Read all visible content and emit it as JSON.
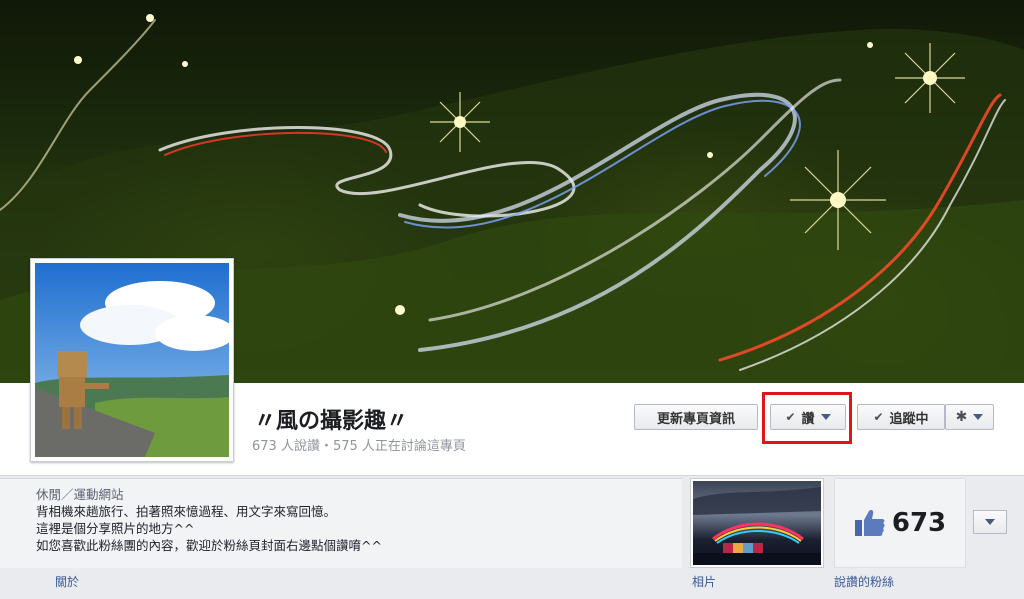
{
  "page": {
    "title": "〃風の攝影趣〃",
    "stats": "673 人說讚・575 人正在討論這專頁"
  },
  "actions": {
    "update_info": "更新專頁資訊",
    "like": "讚",
    "following": "追蹤中"
  },
  "about": {
    "category": "休閒／運動網站",
    "lines": [
      "背相機來趟旅行、拍著照來憶過程、用文字來寫回憶。",
      "這裡是個分享照片的地方^^",
      "如您喜歡此粉絲團的內容，歡迎於粉絲頁封面右邊點個讚唷^^"
    ]
  },
  "tabs": {
    "about": "關於",
    "photos": "相片",
    "likes": "說讚的粉絲"
  },
  "likes_count": "673",
  "icons": {
    "check": "check-icon",
    "caret": "chevron-down-icon",
    "gear": "gear-icon",
    "thumbs_up": "thumbs-up-icon"
  },
  "colors": {
    "link": "#3b5998",
    "highlight": "#e0141a"
  }
}
